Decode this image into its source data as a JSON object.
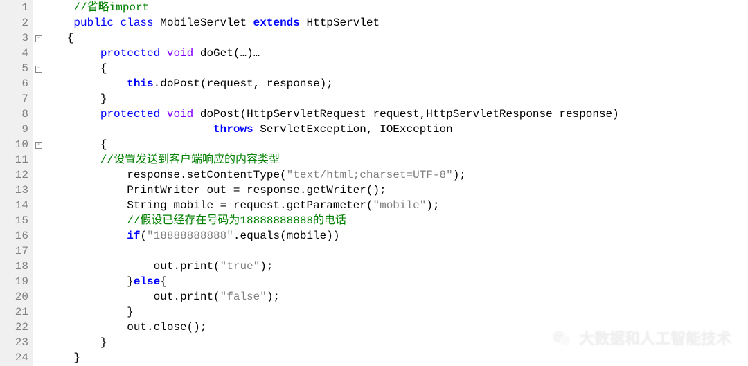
{
  "lineCount": 24,
  "foldMarkers": {
    "3": "minus",
    "5": "minus",
    "10": "minus"
  },
  "code": [
    [
      {
        "cls": "c-default",
        "t": "    "
      },
      {
        "cls": "c-comment",
        "t": "//省略import"
      }
    ],
    [
      {
        "cls": "c-default",
        "t": "    "
      },
      {
        "cls": "c-keyword",
        "t": "public"
      },
      {
        "cls": "c-default",
        "t": " "
      },
      {
        "cls": "c-keyword",
        "t": "class"
      },
      {
        "cls": "c-default",
        "t": " MobileServlet "
      },
      {
        "cls": "c-keyword-b",
        "t": "extends"
      },
      {
        "cls": "c-default",
        "t": " HttpServlet"
      }
    ],
    [
      {
        "cls": "c-default",
        "t": "   {"
      }
    ],
    [
      {
        "cls": "c-default",
        "t": "        "
      },
      {
        "cls": "c-keyword",
        "t": "protected"
      },
      {
        "cls": "c-default",
        "t": " "
      },
      {
        "cls": "c-type",
        "t": "void"
      },
      {
        "cls": "c-default",
        "t": " doGet(…)…"
      }
    ],
    [
      {
        "cls": "c-default",
        "t": "        {"
      }
    ],
    [
      {
        "cls": "c-default",
        "t": "            "
      },
      {
        "cls": "c-keyword-b",
        "t": "this"
      },
      {
        "cls": "c-default",
        "t": ".doPost(request, response);"
      }
    ],
    [
      {
        "cls": "c-default",
        "t": "        }"
      }
    ],
    [
      {
        "cls": "c-default",
        "t": "        "
      },
      {
        "cls": "c-keyword",
        "t": "protected"
      },
      {
        "cls": "c-default",
        "t": " "
      },
      {
        "cls": "c-type",
        "t": "void"
      },
      {
        "cls": "c-default",
        "t": " doPost(HttpServletRequest request,HttpServletResponse response)"
      }
    ],
    [
      {
        "cls": "c-default",
        "t": "                         "
      },
      {
        "cls": "c-keyword-b",
        "t": "throws"
      },
      {
        "cls": "c-default",
        "t": " ServletException, IOException"
      }
    ],
    [
      {
        "cls": "c-default",
        "t": "        {"
      }
    ],
    [
      {
        "cls": "c-default",
        "t": "        "
      },
      {
        "cls": "c-comment",
        "t": "//设置发送到客户端响应的内容类型"
      }
    ],
    [
      {
        "cls": "c-default",
        "t": "            response.setContentType("
      },
      {
        "cls": "c-string",
        "t": "\"text/html;charset=UTF-8\""
      },
      {
        "cls": "c-default",
        "t": ");"
      }
    ],
    [
      {
        "cls": "c-default",
        "t": "            PrintWriter out = response.getWriter();"
      }
    ],
    [
      {
        "cls": "c-default",
        "t": "            String mobile = request.getParameter("
      },
      {
        "cls": "c-string",
        "t": "\"mobile\""
      },
      {
        "cls": "c-default",
        "t": ");"
      }
    ],
    [
      {
        "cls": "c-default",
        "t": "            "
      },
      {
        "cls": "c-comment",
        "t": "//假设已经存在号码为18888888888的电话"
      }
    ],
    [
      {
        "cls": "c-default",
        "t": "            "
      },
      {
        "cls": "c-keyword-b",
        "t": "if"
      },
      {
        "cls": "c-default",
        "t": "("
      },
      {
        "cls": "c-string",
        "t": "\"18888888888\""
      },
      {
        "cls": "c-default",
        "t": ".equals(mobile))"
      }
    ],
    [
      {
        "cls": "c-default",
        "t": ""
      }
    ],
    [
      {
        "cls": "c-default",
        "t": "                out.print("
      },
      {
        "cls": "c-string",
        "t": "\"true\""
      },
      {
        "cls": "c-default",
        "t": ");"
      }
    ],
    [
      {
        "cls": "c-default",
        "t": "            }"
      },
      {
        "cls": "c-keyword-b",
        "t": "else"
      },
      {
        "cls": "c-default",
        "t": "{"
      }
    ],
    [
      {
        "cls": "c-default",
        "t": "                out.print("
      },
      {
        "cls": "c-string",
        "t": "\"false\""
      },
      {
        "cls": "c-default",
        "t": ");"
      }
    ],
    [
      {
        "cls": "c-default",
        "t": "            }"
      }
    ],
    [
      {
        "cls": "c-default",
        "t": "            out.close();"
      }
    ],
    [
      {
        "cls": "c-default",
        "t": "        }"
      }
    ],
    [
      {
        "cls": "c-default",
        "t": "    }"
      }
    ]
  ],
  "watermark": {
    "text": "大数据和人工智能技术"
  }
}
